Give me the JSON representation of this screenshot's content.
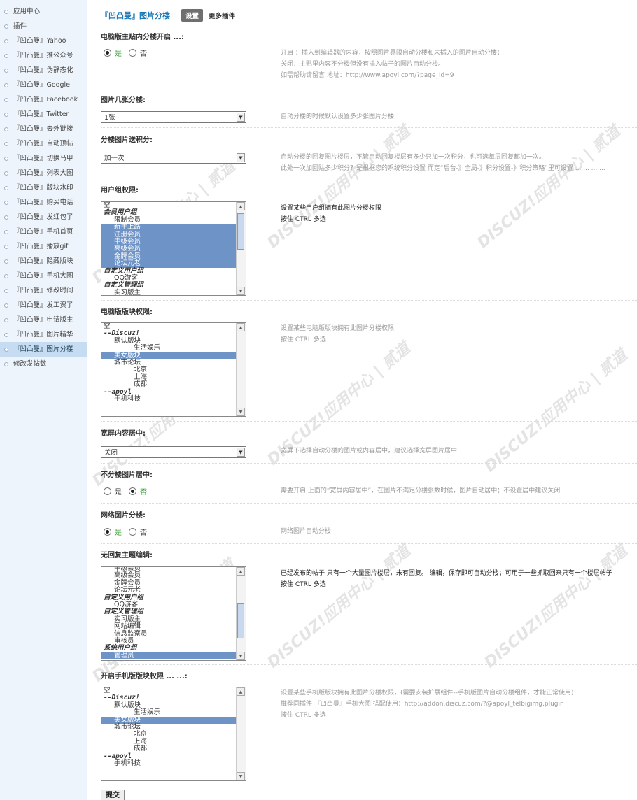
{
  "sidebar": {
    "items": [
      "应用中心",
      "插件",
      "『凹凸曼』Yahoo",
      "『凹凸曼』推公众号",
      "『凹凸曼』伪静态化",
      "『凹凸曼』Google",
      "『凹凸曼』Facebook",
      "『凹凸曼』Twitter",
      "『凹凸曼』去外链接",
      "『凹凸曼』自动顶帖",
      "『凹凸曼』切换马甲",
      "『凹凸曼』列表大图",
      "『凹凸曼』版块水印",
      "『凹凸曼』购买电话",
      "『凹凸曼』发红包了",
      "『凹凸曼』手机首页",
      "『凹凸曼』播放gif",
      "『凹凸曼』隐藏版块",
      "『凹凸曼』手机大图",
      "『凹凸曼』修改时间",
      "『凹凸曼』发工资了",
      "『凹凸曼』申请版主",
      "『凹凸曼』图片精华",
      "『凹凸曼』图片分楼",
      "修改发帖数"
    ],
    "active_index": 23
  },
  "header": {
    "title": "『凹凸曼』图片分楼",
    "settings_button": "设置",
    "more_plugins": "更多插件"
  },
  "settings": {
    "pc_enable": {
      "label": "电脑版主贴内分楼开启 ...:",
      "yes": "是",
      "no": "否",
      "selected": "yes",
      "desc": [
        "开启 ：插入到编辑器的内容，按照图片界限自动分楼和未插入的图片自动分楼；",
        "关闭：主贴里内容不分楼但没有插入帖子的图片自动分楼。",
        "如需帮助请留言 地址：http://www.apoyl.com/?page_id=9"
      ]
    },
    "image_count": {
      "label": "图片几张分楼:",
      "value": "1张",
      "desc": "自动分楼的时候默认设置多少张图片分楼"
    },
    "credits": {
      "label": "分楼图片送积分:",
      "value": "加一次",
      "desc": [
        "自动分楼的回复图片楼层，不管自动回复楼层有多少只加一次积分，也可选每层回复都加一次。",
        "此处一次加回贴多少积分？是根据您的系统积分设置 而定“后台-》全局-》积分设置-》积分策略”里可设置 ... ... ... ..."
      ]
    },
    "usergroup": {
      "label": "用户组权限:",
      "desc": [
        "设置某些用户组拥有此图片分楼权限",
        "按住 CTRL 多选"
      ],
      "options": [
        {
          "t": "空",
          "k": "n"
        },
        {
          "t": "会员用户组",
          "k": "g"
        },
        {
          "t": "限制会员",
          "k": "i"
        },
        {
          "t": "新手上路",
          "k": "s"
        },
        {
          "t": "注册会员",
          "k": "s"
        },
        {
          "t": "中级会员",
          "k": "s"
        },
        {
          "t": "高级会员",
          "k": "s"
        },
        {
          "t": "金牌会员",
          "k": "s"
        },
        {
          "t": "论坛元老",
          "k": "s"
        },
        {
          "t": "自定义用户组",
          "k": "g"
        },
        {
          "t": "QQ游客",
          "k": "i"
        },
        {
          "t": "自定义管理组",
          "k": "g"
        },
        {
          "t": "实习版主",
          "k": "i"
        }
      ]
    },
    "pc_forums": {
      "label": "电脑版版块权限:",
      "desc": [
        "设置某些电脑版版块拥有此图片分楼权限",
        "按住 CTRL 多选"
      ],
      "options": [
        {
          "t": "空",
          "k": "n"
        },
        {
          "t": "--Discuz!",
          "k": "m"
        },
        {
          "t": "默认版块",
          "k": "i"
        },
        {
          "t": "生活娱乐",
          "k": "i3"
        },
        {
          "t": "美女版块",
          "k": "s"
        },
        {
          "t": "城市论坛",
          "k": "i"
        },
        {
          "t": "北京",
          "k": "i4"
        },
        {
          "t": "上海",
          "k": "i4"
        },
        {
          "t": "成都",
          "k": "i4"
        },
        {
          "t": "--apoyl",
          "k": "m"
        },
        {
          "t": "手机科技",
          "k": "i"
        }
      ]
    },
    "widescreen": {
      "label": "宽屏内容居中:",
      "value": "关闭",
      "desc": "宽屏下选择自动分楼的图片或内容居中，建议选择宽屏图片居中"
    },
    "center_image": {
      "label": "不分楼图片居中:",
      "yes": "是",
      "no": "否",
      "selected": "no",
      "desc": "需要开启 上面的“宽屏内容居中”，在图片不满足分楼张数时候，图片自动居中；不设置居中建议关闭"
    },
    "network_image": {
      "label": "网络图片分楼:",
      "yes": "是",
      "no": "否",
      "selected": "yes",
      "desc": "网络图片自动分楼"
    },
    "no_reply_edit": {
      "label": "无回复主题编辑:",
      "desc": [
        "已经发布的帖子 只有一个大量图片楼层，未有回复。 编辑，保存即可自动分楼；可用于一些抓取回来只有一个楼层帖子",
        "按住 CTRL 多选"
      ],
      "options": [
        {
          "t": "中级会员",
          "k": "i"
        },
        {
          "t": "高级会员",
          "k": "i"
        },
        {
          "t": "金牌会员",
          "k": "i"
        },
        {
          "t": "论坛元老",
          "k": "i"
        },
        {
          "t": "自定义用户组",
          "k": "g"
        },
        {
          "t": "QQ游客",
          "k": "i"
        },
        {
          "t": "自定义管理组",
          "k": "g"
        },
        {
          "t": "实习版主",
          "k": "i"
        },
        {
          "t": "网站编辑",
          "k": "i"
        },
        {
          "t": "信息监察员",
          "k": "i"
        },
        {
          "t": "审核员",
          "k": "i"
        },
        {
          "t": "系统用户组",
          "k": "g"
        },
        {
          "t": "管理员",
          "k": "s"
        }
      ]
    },
    "mobile_forums": {
      "label": "开启手机版版块权限 ... ...:",
      "desc": [
        "设置某些手机版版块拥有此图片分楼权限，(需要安装扩展组件--手机版图片自动分楼组件，才能正常使用)",
        "推荐同插件 『凹凸曼』手机大图 搭配使用：http://addon.discuz.com/?@apoyl_telbigimg.plugin",
        "按住 CTRL 多选"
      ],
      "options": [
        {
          "t": "空",
          "k": "n"
        },
        {
          "t": "--Discuz!",
          "k": "m"
        },
        {
          "t": "默认版块",
          "k": "i"
        },
        {
          "t": "生活娱乐",
          "k": "i3"
        },
        {
          "t": "美女版块",
          "k": "s"
        },
        {
          "t": "城市论坛",
          "k": "i"
        },
        {
          "t": "北京",
          "k": "i4"
        },
        {
          "t": "上海",
          "k": "i4"
        },
        {
          "t": "成都",
          "k": "i4"
        },
        {
          "t": "--apoyl",
          "k": "m"
        },
        {
          "t": "手机科技",
          "k": "i"
        }
      ]
    }
  },
  "submit_label": "提交",
  "watermark_text": "DISCUZ!应用中心 | 贰道"
}
